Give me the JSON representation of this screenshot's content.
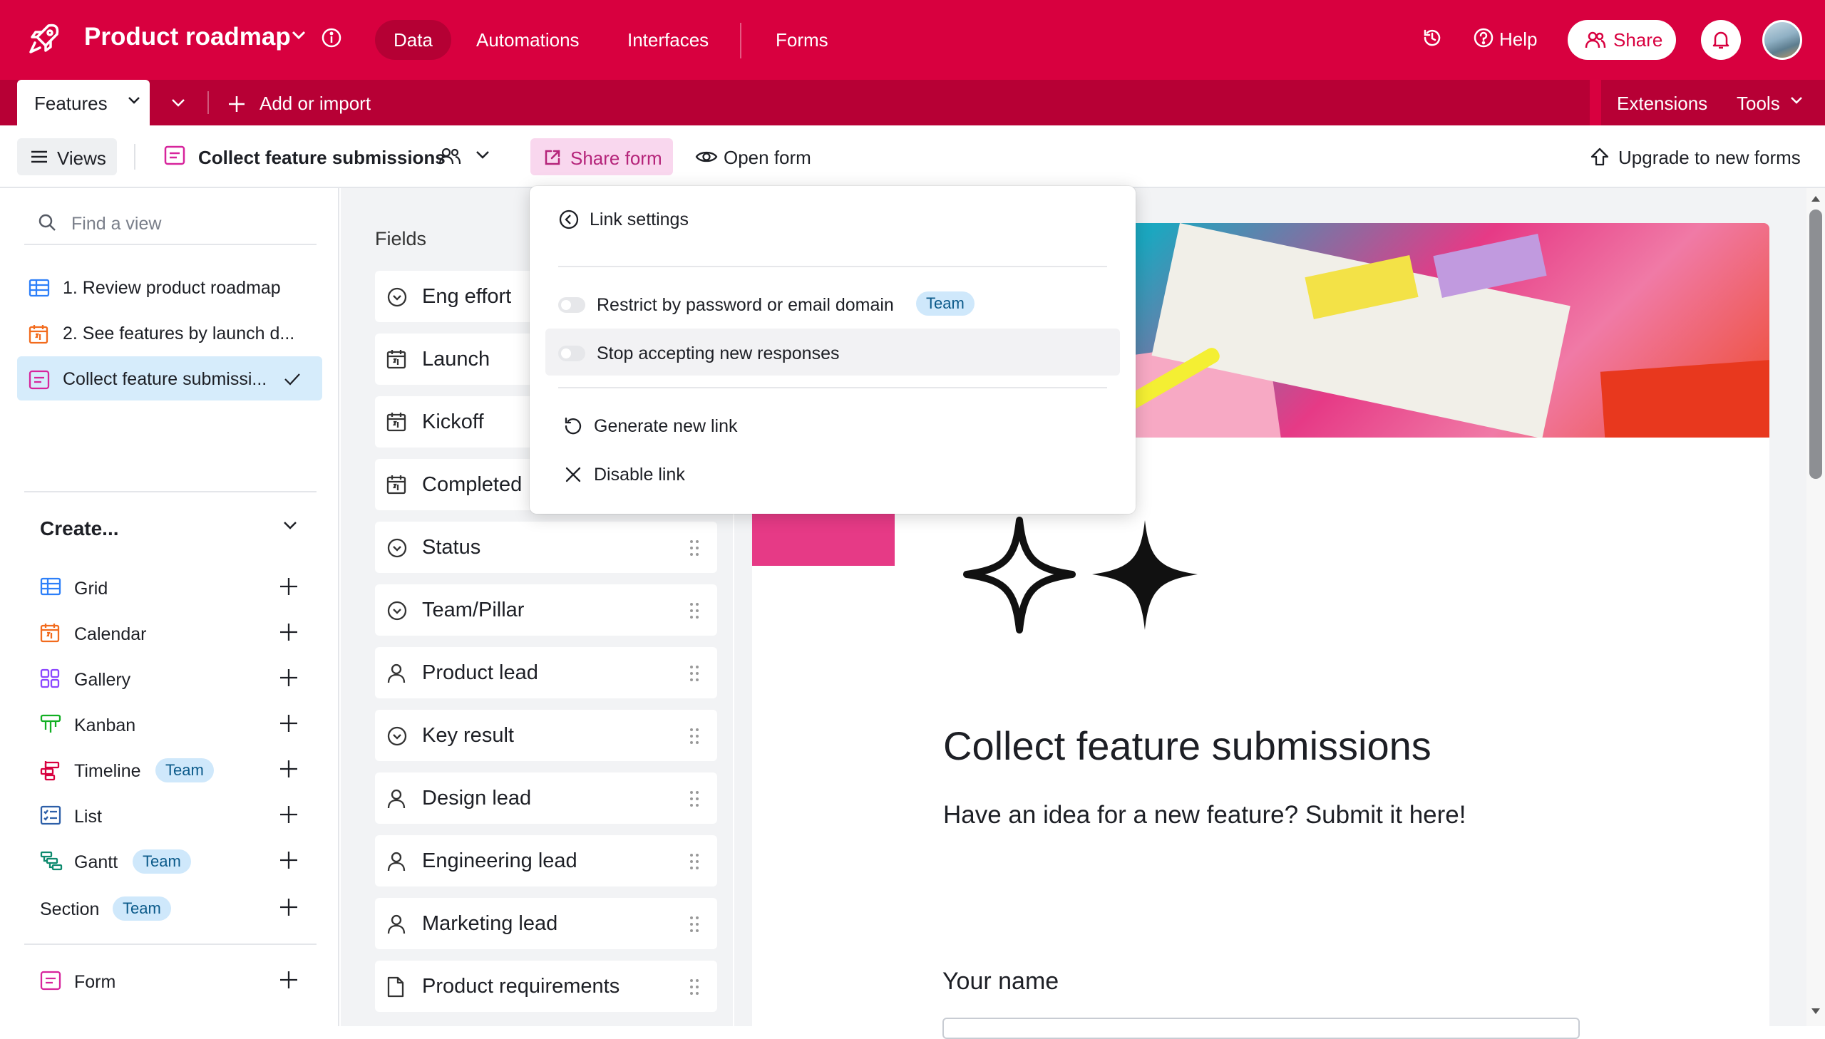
{
  "app": {
    "title": "Product roadmap",
    "nav": [
      "Data",
      "Automations",
      "Interfaces",
      "Forms"
    ],
    "help_label": "Help",
    "share_label": "Share"
  },
  "tablebar": {
    "active_table": "Features",
    "add_import": "Add or import",
    "extensions": "Extensions",
    "tools": "Tools"
  },
  "viewbar": {
    "views_label": "Views",
    "current_view": "Collect feature submissions",
    "share_form": "Share form",
    "open_form": "Open form",
    "upgrade": "Upgrade to new forms"
  },
  "sidebar": {
    "search_placeholder": "Find a view",
    "views": [
      {
        "label": "1. Review product roadmap",
        "icon": "grid-icon"
      },
      {
        "label": "2. See features by launch d...",
        "icon": "calendar-icon"
      },
      {
        "label": "Collect feature submissi...",
        "icon": "form-icon",
        "active": true
      }
    ],
    "create_label": "Create...",
    "create_items": [
      {
        "label": "Grid",
        "icon": "grid-icon",
        "color": "#2d7ff9"
      },
      {
        "label": "Calendar",
        "icon": "calendar-icon",
        "color": "#f26b1d"
      },
      {
        "label": "Gallery",
        "icon": "gallery-icon",
        "color": "#8b46ff"
      },
      {
        "label": "Kanban",
        "icon": "kanban-icon",
        "color": "#11af22"
      },
      {
        "label": "Timeline",
        "icon": "timeline-icon",
        "color": "#d8003f",
        "badge": "Team"
      },
      {
        "label": "List",
        "icon": "list-icon",
        "color": "#2d5fa8"
      },
      {
        "label": "Gantt",
        "icon": "gantt-icon",
        "color": "#0e8a6e",
        "badge": "Team"
      },
      {
        "label": "Section",
        "badge": "Team"
      },
      {
        "label": "Form",
        "icon": "form-icon",
        "color": "#d7249c"
      }
    ]
  },
  "fields": {
    "title": "Fields",
    "items": [
      {
        "label": "Eng effort",
        "icon": "single-select-icon"
      },
      {
        "label": "Launch",
        "icon": "calendar-icon"
      },
      {
        "label": "Kickoff",
        "icon": "calendar-icon"
      },
      {
        "label": "Completed",
        "icon": "calendar-icon"
      },
      {
        "label": "Status",
        "icon": "single-select-icon"
      },
      {
        "label": "Team/Pillar",
        "icon": "single-select-icon"
      },
      {
        "label": "Product lead",
        "icon": "user-icon"
      },
      {
        "label": "Key result",
        "icon": "single-select-icon"
      },
      {
        "label": "Design lead",
        "icon": "user-icon"
      },
      {
        "label": "Engineering lead",
        "icon": "user-icon"
      },
      {
        "label": "Marketing lead",
        "icon": "user-icon"
      },
      {
        "label": "Product requirements",
        "icon": "document-icon"
      }
    ]
  },
  "form": {
    "title": "Collect feature submissions",
    "description": "Have an idea for a new feature? Submit it here!",
    "first_field_label": "Your name"
  },
  "popover": {
    "back_label": "Link settings",
    "restrict_label": "Restrict by password or email domain",
    "restrict_badge": "Team",
    "stop_label": "Stop accepting new responses",
    "generate_label": "Generate new link",
    "disable_label": "Disable link"
  },
  "colors": {
    "brand": "#d8003f",
    "share_form_bg": "#f9d7ee",
    "active_view_bg": "#d6ecfb",
    "badge_bg": "#cfe8fb"
  }
}
